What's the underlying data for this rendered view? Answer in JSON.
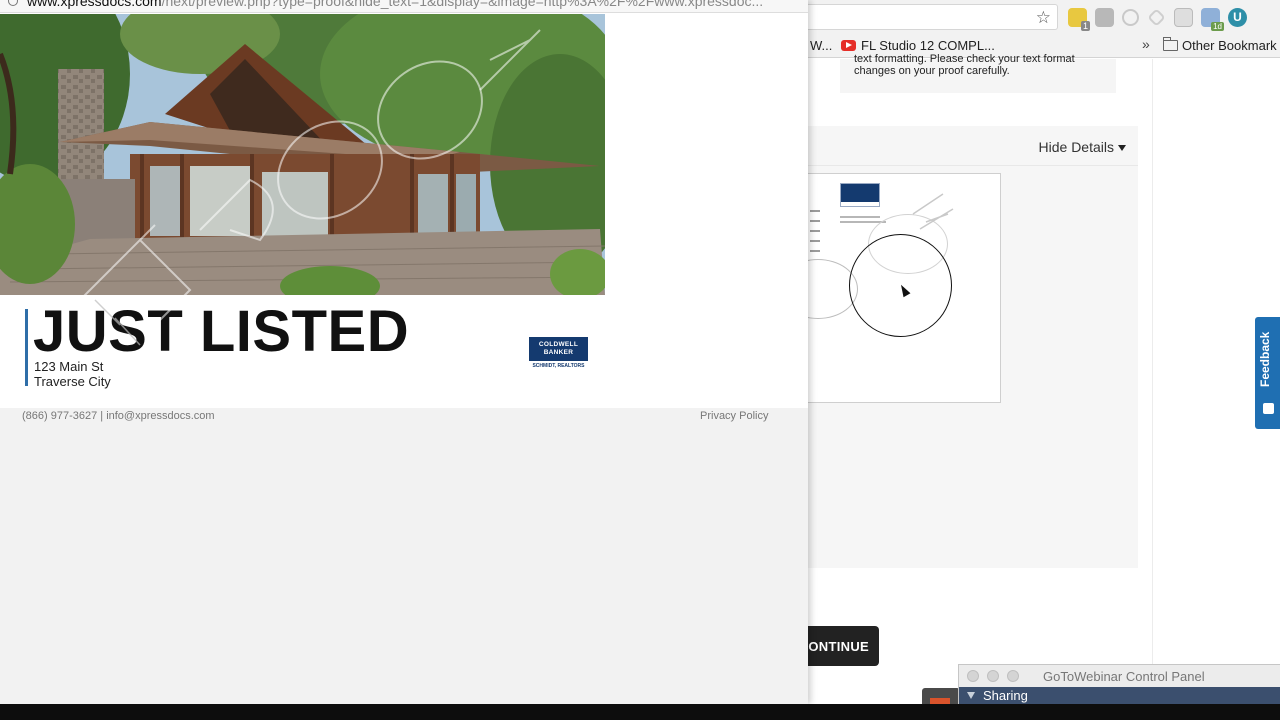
{
  "preview": {
    "url_host": "www.xpressdocs.com",
    "url_path": "/next/preview.php?type=proof&hide_text=1&display=&image=http%3A%2F%2Fwww.xpressdoc..."
  },
  "flyer": {
    "headline": "JUST LISTED",
    "address_line1": "123 Main St",
    "address_line2": "Traverse City",
    "watermark": "PROOF",
    "brand_line1": "COLDWELL",
    "brand_line2": "BANKER",
    "brand_sub": "SCHMIDT, REALTORS"
  },
  "footer": {
    "contact": "(866) 977-3627 | info@xpressdocs.com",
    "privacy": "Privacy Policy"
  },
  "bookmarks": {
    "truncated": "W...",
    "fl_studio": "FL Studio 12 COMPL...",
    "more": "»",
    "other": "Other Bookmark"
  },
  "page": {
    "notice": "text formatting. Please check your text format changes on your proof carefully.",
    "hide_details": "Hide Details",
    "continue": "ONTINUE",
    "feedback": "Feedback"
  },
  "gotowebinar": {
    "title": "GoToWebinar Control Panel",
    "section": "Sharing"
  },
  "icons": {
    "star": "bookmark-star-icon",
    "caret": "caret-down-icon",
    "youtube": "youtube-icon",
    "folder": "folder-icon"
  }
}
